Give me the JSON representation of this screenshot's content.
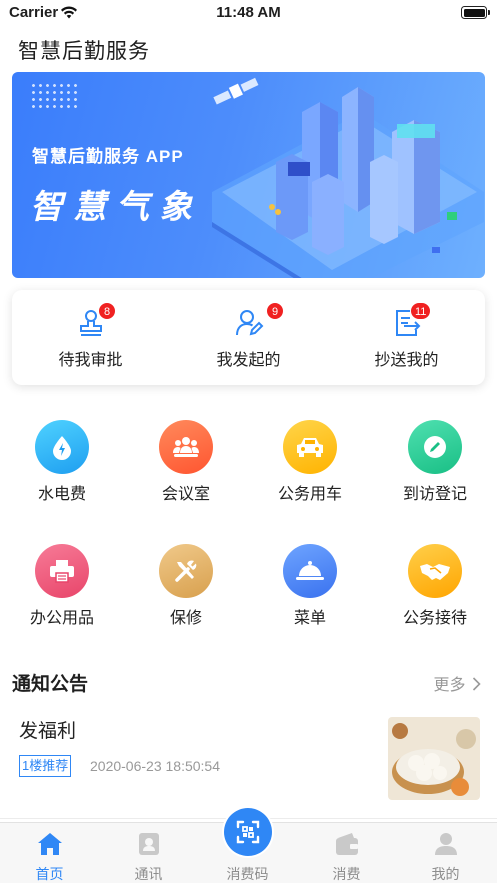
{
  "status_bar": {
    "carrier": "Carrier",
    "time": "11:48 AM"
  },
  "app": {
    "title": "智慧后勤服务"
  },
  "banner": {
    "subtitle": "智慧后勤服务 APP",
    "headline": "智慧气象"
  },
  "approvals": [
    {
      "label": "待我审批",
      "badge": "8",
      "icon": "stamp-icon"
    },
    {
      "label": "我发起的",
      "badge": "9",
      "icon": "user-edit-icon"
    },
    {
      "label": "抄送我的",
      "badge": "11",
      "icon": "document-forward-icon"
    }
  ],
  "services": [
    {
      "label": "水电费",
      "icon": "water-power-icon",
      "color": "#29b6f6"
    },
    {
      "label": "会议室",
      "icon": "meeting-room-icon",
      "color": "#ff6a3d"
    },
    {
      "label": "公务用车",
      "icon": "car-icon",
      "color": "#ffc107"
    },
    {
      "label": "到访登记",
      "icon": "pen-icon",
      "color": "#2ccf9a"
    },
    {
      "label": "办公用品",
      "icon": "printer-icon",
      "color": "#ef5a78"
    },
    {
      "label": "保修",
      "icon": "tools-icon",
      "color": "#e0b063"
    },
    {
      "label": "菜单",
      "icon": "cloche-icon",
      "color": "#3d7ff5"
    },
    {
      "label": "公务接待",
      "icon": "handshake-icon",
      "color": "#ffb300"
    }
  ],
  "notice": {
    "section_title": "通知公告",
    "more_label": "更多",
    "items": [
      {
        "title": "发福利",
        "tag": "1楼推荐",
        "date": "2020-06-23 18:50:54"
      }
    ]
  },
  "tabs": [
    {
      "label": "首页",
      "icon": "home-icon",
      "active": true
    },
    {
      "label": "通讯",
      "icon": "contacts-icon",
      "active": false
    },
    {
      "label": "消费码",
      "icon": "scan-icon",
      "active": false
    },
    {
      "label": "消费",
      "icon": "wallet-icon",
      "active": false
    },
    {
      "label": "我的",
      "icon": "profile-icon",
      "active": false
    }
  ],
  "colors": {
    "accent": "#2f87f5",
    "badge": "#f02121"
  }
}
